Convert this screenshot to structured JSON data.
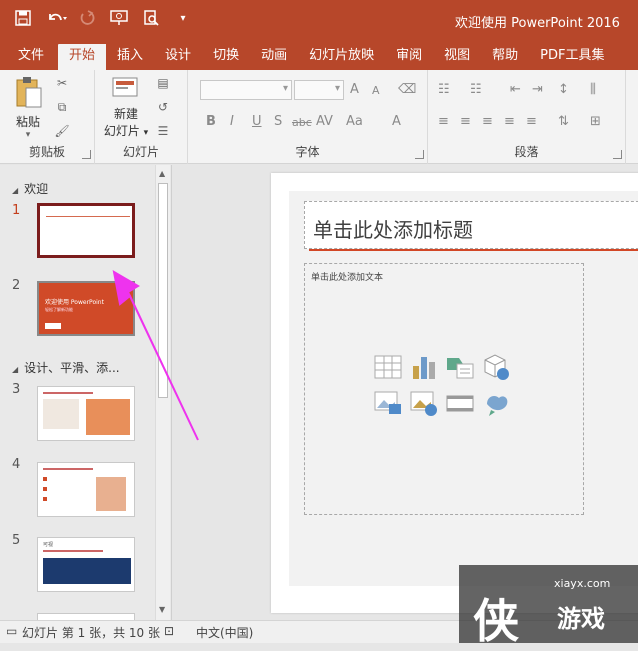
{
  "window": {
    "title": "欢迎使用 PowerPoint 2016",
    "title_suffix": "Po"
  },
  "qat": {
    "icons": [
      "save-icon",
      "undo-icon",
      "redo-icon",
      "slideshow-icon",
      "preview-icon",
      "customize-icon"
    ]
  },
  "tabs": [
    {
      "label": "文件"
    },
    {
      "label": "开始",
      "active": true
    },
    {
      "label": "插入"
    },
    {
      "label": "设计"
    },
    {
      "label": "切换"
    },
    {
      "label": "动画"
    },
    {
      "label": "幻灯片放映"
    },
    {
      "label": "审阅"
    },
    {
      "label": "视图"
    },
    {
      "label": "帮助"
    },
    {
      "label": "PDF工具集"
    }
  ],
  "ribbon": {
    "clipboard": {
      "label": "剪贴板",
      "paste": "粘贴"
    },
    "slides": {
      "label": "幻灯片",
      "new_slide_line1": "新建",
      "new_slide_line2": "幻灯片"
    },
    "font": {
      "label": "字体",
      "bold": "B",
      "italic": "I",
      "underline": "U",
      "strike": "S",
      "shadow": "abc",
      "spacing": "AV",
      "case": "Aa",
      "color": "A",
      "grow": "A",
      "shrink": "A"
    },
    "paragraph": {
      "label": "段落"
    }
  },
  "thumbnails": {
    "sections": [
      {
        "label": "欢迎"
      },
      {
        "label": "设计、平滑、添..."
      }
    ],
    "slides": [
      {
        "num": "1"
      },
      {
        "num": "2",
        "title": "欢迎使用 PowerPoint",
        "subtitle": "轻松了解新功能"
      },
      {
        "num": "3"
      },
      {
        "num": "4"
      },
      {
        "num": "5",
        "header": "可视"
      }
    ]
  },
  "slide": {
    "title_placeholder": "单击此处添加标题",
    "body_placeholder": "单击此处添加文本"
  },
  "status": {
    "slide_count": "幻灯片 第 1 张，共 10 张",
    "language": "中文(中国)"
  },
  "watermark": {
    "url": "xiayx.com",
    "big": "侠",
    "name": "游戏"
  },
  "colors": {
    "accent": "#b7472a",
    "selection": "#7b1c1c",
    "arrow": "#ee33ee"
  }
}
